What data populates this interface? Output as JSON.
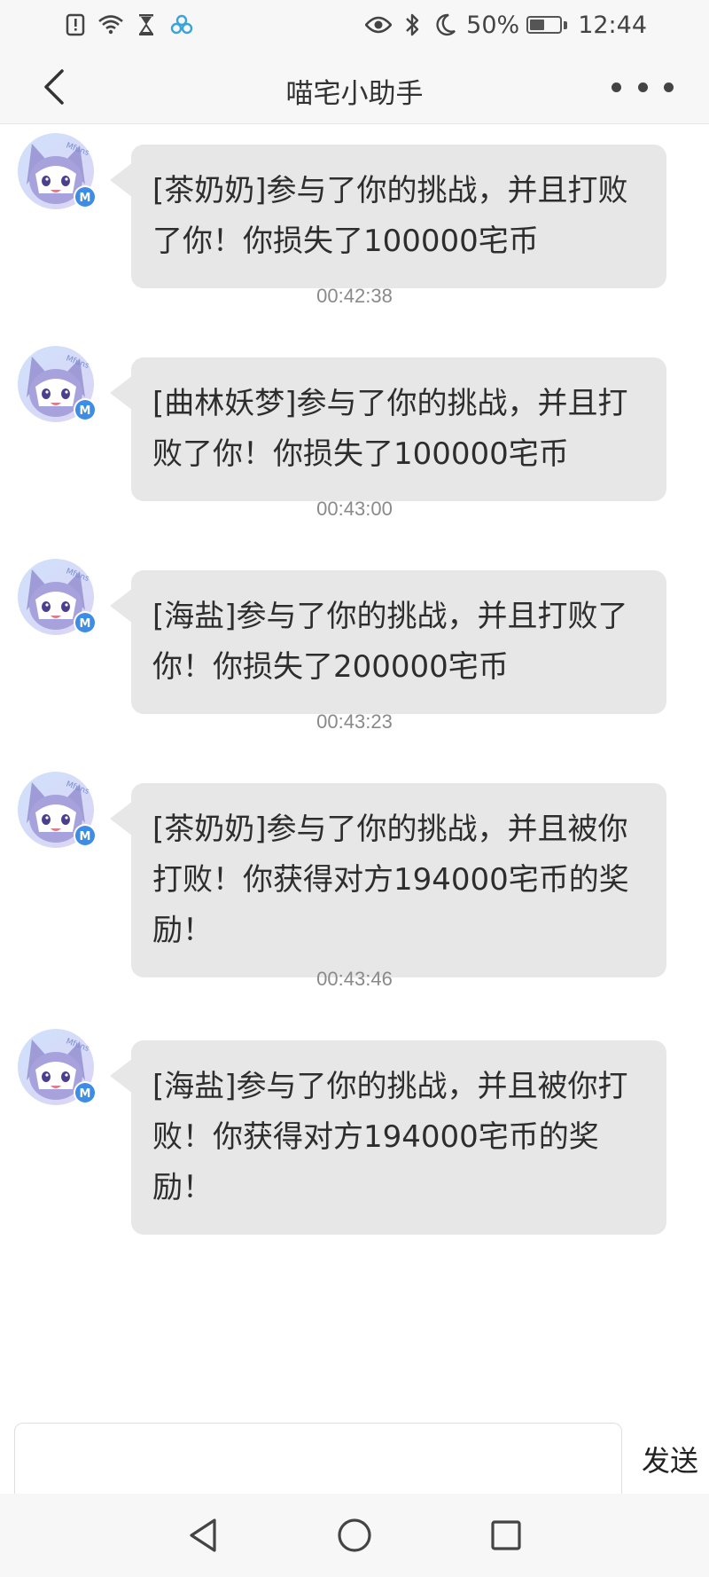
{
  "status_bar": {
    "battery_percent": "50%",
    "battery_level": 0.5,
    "time": "12:44",
    "left_icons": [
      "alert-icon",
      "wifi-icon",
      "hourglass-icon",
      "cloud-app-icon"
    ],
    "right_icons": [
      "eye-icon",
      "bluetooth-icon",
      "moon-icon"
    ]
  },
  "nav": {
    "title": "喵宅小助手"
  },
  "messages": [
    {
      "text": "[茶奶奶]参与了你的挑战，并且打败了你！你损失了100000宅币"
    },
    {
      "timestamp": "00:42:38",
      "text": "[曲林妖梦]参与了你的挑战，并且打败了你！你损失了100000宅币"
    },
    {
      "timestamp": "00:43:00",
      "text": "[海盐]参与了你的挑战，并且打败了你！你损失了200000宅币"
    },
    {
      "timestamp": "00:43:23",
      "text": "[茶奶奶]参与了你的挑战，并且被你打败！你获得对方194000宅币的奖励！"
    },
    {
      "timestamp": "00:43:46",
      "text": "[海盐]参与了你的挑战，并且被你打败！你获得对方194000宅币的奖励！"
    }
  ],
  "avatar": {
    "caption": "Mfuns",
    "badge_letter": "M"
  },
  "composer": {
    "input_value": "",
    "send_label": "发送"
  },
  "colors": {
    "bubble": "#e7e7e7",
    "badge": "#3d8ce6",
    "bar": "#f7f7f7"
  }
}
